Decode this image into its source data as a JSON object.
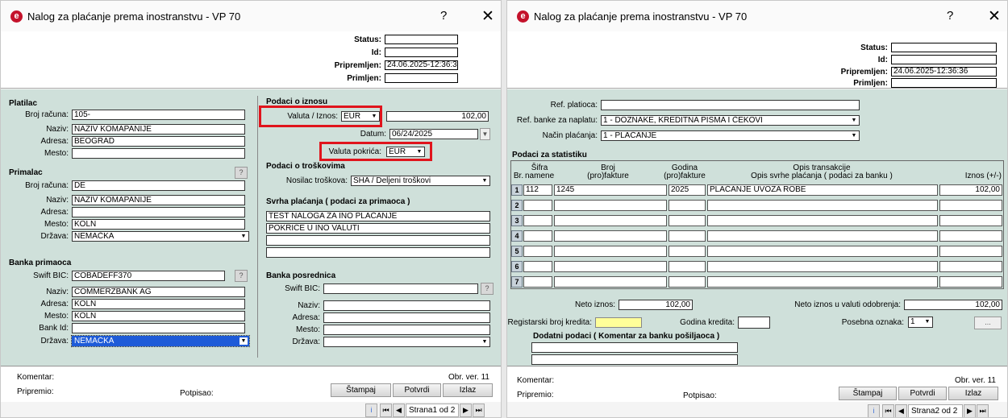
{
  "window_title": "Nalog za plaćanje prema inostranstvu - VP 70",
  "help_label": "?",
  "close_label": "✕",
  "icons": {
    "logo": "e-logo-icon",
    "dropdown": "triangle-down-icon",
    "help": "question-icon",
    "close": "x-icon"
  },
  "colors": {
    "panel": "#cfe0da",
    "highlight": "#e0141c",
    "yellow": "#ffff99",
    "selected": "#1e5bd8"
  },
  "header": {
    "status_label": "Status:",
    "status_value": "",
    "id_label": "Id:",
    "id_value": "",
    "pripremljen_label": "Pripremljen:",
    "pripremljen_value": "24.06.2025-12:36:36",
    "primljen_label": "Primljen:",
    "primljen_value": ""
  },
  "w1": {
    "platilac": {
      "title": "Platilac",
      "broj_label": "Broj računa:",
      "broj_value": "105-",
      "naziv_label": "Naziv:",
      "naziv_value": "NAZIV KOMAPANIJE",
      "adresa_label": "Adresa:",
      "adresa_value": "BEOGRAD",
      "mesto_label": "Mesto:",
      "mesto_value": ""
    },
    "primalac": {
      "title": "Primalac",
      "broj_label": "Broj računa:",
      "broj_value": "DE",
      "naziv_label": "Naziv:",
      "naziv_value": "NAZIV KOMAPANIJE",
      "adresa_label": "Adresa:",
      "adresa_value": "",
      "mesto_label": "Mesto:",
      "mesto_value": "KOLN",
      "drzava_label": "Država:",
      "drzava_value": "NEMAČKA",
      "help": "?"
    },
    "banka_primaoca": {
      "title": "Banka primaoca",
      "swift_label": "Swift BIC:",
      "swift_value": "COBADEFF370",
      "naziv_label": "Naziv:",
      "naziv_value": "COMMERZBANK AG",
      "adresa_label": "Adresa:",
      "adresa_value": "KOLN",
      "mesto_label": "Mesto:",
      "mesto_value": "KOLN",
      "bankid_label": "Bank Id:",
      "bankid_value": "",
      "drzava_label": "Država:",
      "drzava_value": "NEMAČKA"
    },
    "podaci_o_iznosu": {
      "title": "Podaci o iznosu",
      "valuta_label": "Valuta / Iznos:",
      "valuta_value": "EUR",
      "iznos_value": "102,00",
      "datum_label": "Datum:",
      "datum_value": "06/24/2025",
      "valuta_pokrica_label": "Valuta pokrića:",
      "valuta_pokrica_value": "EUR"
    },
    "troskovi": {
      "title": "Podaci o troškovima",
      "nosilac_label": "Nosilac troškova:",
      "nosilac_value": "SHA / Deljeni troškovi"
    },
    "svrha": {
      "title": "Svrha plaćanja ( podaci za primaoca )",
      "lines": [
        "TEST NALOGA ZA INO PLAĆANJE",
        "POKRIĆE U INO VALUTI",
        "",
        ""
      ]
    },
    "banka_posrednica": {
      "title": "Banka posrednica",
      "swift_label": "Swift BIC:",
      "swift_value": "",
      "naziv_label": "Naziv:",
      "naziv_value": "",
      "adresa_label": "Adresa:",
      "adresa_value": "",
      "mesto_label": "Mesto:",
      "mesto_value": "",
      "drzava_label": "Država:",
      "drzava_value": "",
      "help": "?"
    },
    "footer": {
      "komentar_label": "Komentar:",
      "obr_ver": "Obr. ver. 11",
      "pripremio_label": "Pripremio:",
      "potpisao_label": "Potpisao:",
      "stampaj": "Štampaj",
      "potvrdi": "Potvrdi",
      "izlaz": "Izlaz",
      "page": "Strana1 od 2",
      "info": "i",
      "first": "⏮",
      "prev": "◀",
      "next": "▶",
      "last": "⏭"
    }
  },
  "w2": {
    "ref_platioca_label": "Ref. platioca:",
    "ref_platioca_value": "",
    "ref_banke_label": "Ref. banke za naplatu:",
    "ref_banke_value": "1 - DOZNAKE, KREDITNA PISMA I ČEKOVI",
    "nacin_label": "Način plaćanja:",
    "nacin_value": "1 - PLAĆANJE",
    "statistika_title": "Podaci za statistiku",
    "columns": {
      "br": "Br.",
      "sifra": "Šifra\nnamene",
      "broj": "Broj\n(pro)fakture",
      "godina": "Godina\n(pro)fakture",
      "opis": "Opis transakcije\nOpis svrhe plaćanja ( podaci za banku )",
      "iznos": "Iznos (+/-)"
    },
    "rows": [
      {
        "br": "1",
        "sifra": "112",
        "broj": "1245",
        "godina": "2025",
        "opis": "PLAĆANJE UVOZA ROBE",
        "iznos": "102,00"
      },
      {
        "br": "2",
        "sifra": "",
        "broj": "",
        "godina": "",
        "opis": "",
        "iznos": ""
      },
      {
        "br": "3",
        "sifra": "",
        "broj": "",
        "godina": "",
        "opis": "",
        "iznos": ""
      },
      {
        "br": "4",
        "sifra": "",
        "broj": "",
        "godina": "",
        "opis": "",
        "iznos": ""
      },
      {
        "br": "5",
        "sifra": "",
        "broj": "",
        "godina": "",
        "opis": "",
        "iznos": ""
      },
      {
        "br": "6",
        "sifra": "",
        "broj": "",
        "godina": "",
        "opis": "",
        "iznos": ""
      },
      {
        "br": "7",
        "sifra": "",
        "broj": "",
        "godina": "",
        "opis": "",
        "iznos": ""
      }
    ],
    "neto_label": "Neto iznos:",
    "neto_value": "102,00",
    "neto_valuta_label": "Neto iznos u valuti odobrenja:",
    "neto_valuta_value": "102,00",
    "reg_label": "Registarski broj kredita:",
    "reg_value": "",
    "godina_label": "Godina kredita:",
    "godina_value": "",
    "posebna_label": "Posebna oznaka:",
    "posebna_value": "1",
    "dots": "...",
    "dodatni_title": "Dodatni podaci ( Komentar za banku pošiljaoca )",
    "dodatni_lines": [
      "",
      ""
    ],
    "footer": {
      "komentar_label": "Komentar:",
      "obr_ver": "Obr. ver. 11",
      "pripremio_label": "Pripremio:",
      "potpisao_label": "Potpisao:",
      "stampaj": "Štampaj",
      "potvrdi": "Potvrdi",
      "izlaz": "Izlaz",
      "page": "Strana2 od 2",
      "info": "i",
      "first": "⏮",
      "prev": "◀",
      "next": "▶",
      "last": "⏭"
    }
  }
}
